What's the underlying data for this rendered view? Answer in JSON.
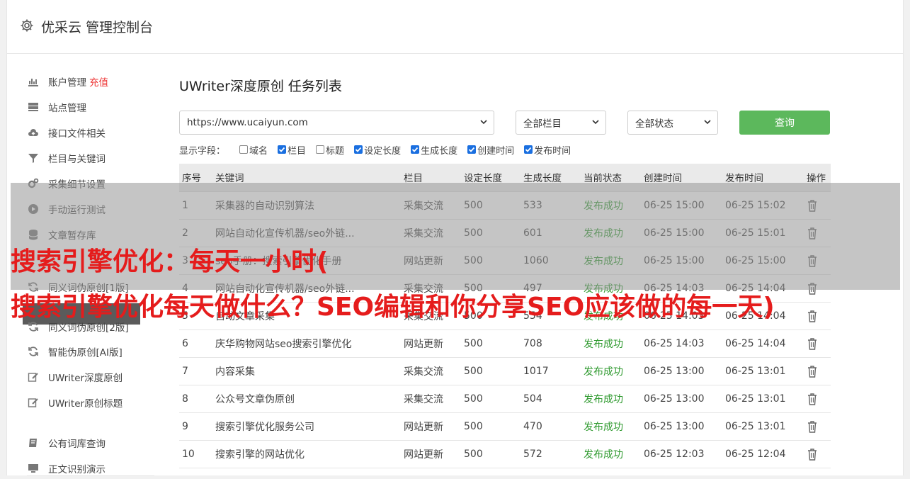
{
  "app": {
    "title": "优采云 管理控制台"
  },
  "sidebar": {
    "items": [
      {
        "label": "账户管理",
        "extra": "充值",
        "icon": "bar-chart-icon"
      },
      {
        "label": "站点管理",
        "icon": "server-icon"
      },
      {
        "label": "接口文件相关",
        "icon": "cloud-upload-icon"
      },
      {
        "label": "栏目与关键词",
        "icon": "filter-icon"
      },
      {
        "label": "采集细节设置",
        "icon": "cogs-icon"
      },
      {
        "label": "手动运行测试",
        "icon": "play-icon"
      },
      {
        "label": "文章暂存库",
        "icon": "database-icon"
      },
      {
        "label": "深度原创任务",
        "icon": "edit-icon"
      },
      {
        "label": "同义词伪原创[1版]",
        "icon": "refresh-icon"
      },
      {
        "label": "同义词伪原创[2版]",
        "icon": "refresh-icon"
      },
      {
        "label": "智能伪原创[AI版]",
        "icon": "refresh-icon"
      },
      {
        "label": "UWriter深度原创",
        "icon": "edit-icon"
      },
      {
        "label": "UWriter原创标题",
        "icon": "edit-icon"
      },
      {
        "label": "公有词库查询",
        "icon": "book-icon"
      },
      {
        "label": "正文识别演示",
        "icon": "monitor-icon"
      }
    ]
  },
  "main": {
    "title": "UWriter深度原创 任务列表",
    "site_select": "https://www.ucaiyun.com",
    "column_select": "全部栏目",
    "status_select": "全部状态",
    "query_label": "查询",
    "fields_label": "显示字段：",
    "fields": [
      {
        "label": "域名",
        "checked": false
      },
      {
        "label": "栏目",
        "checked": true
      },
      {
        "label": "标题",
        "checked": false
      },
      {
        "label": "设定长度",
        "checked": true
      },
      {
        "label": "生成长度",
        "checked": true
      },
      {
        "label": "创建时间",
        "checked": true
      },
      {
        "label": "发布时间",
        "checked": true
      }
    ],
    "table": {
      "headers": [
        "序号",
        "关键词",
        "栏目",
        "设定长度",
        "生成长度",
        "当前状态",
        "创建时间",
        "发布时间",
        "操作"
      ],
      "rows": [
        [
          "1",
          "采集器的自动识别算法",
          "采集交流",
          "500",
          "533",
          "发布成功",
          "06-25 15:00",
          "06-25 15:02"
        ],
        [
          "2",
          "网站自动化宣传机器/seo外链...",
          "采集交流",
          "500",
          "601",
          "发布成功",
          "06-25 15:00",
          "06-25 15:01"
        ],
        [
          "3",
          "seo手册：搜索引擎优化手册",
          "网站更新",
          "500",
          "1060",
          "发布成功",
          "06-25 15:00",
          "06-25 15:00"
        ],
        [
          "4",
          "网站自动化宣传机器/seo外链...",
          "采集交流",
          "500",
          "497",
          "发布成功",
          "06-25 14:03",
          "06-25 14:04"
        ],
        [
          "5",
          "自动文章采集",
          "采集交流",
          "500",
          "554",
          "发布成功",
          "06-25 14:03",
          "06-25 14:04"
        ],
        [
          "6",
          "庆华购物网站seo搜索引擎优化",
          "网站更新",
          "500",
          "708",
          "发布成功",
          "06-25 14:03",
          "06-25 14:04"
        ],
        [
          "7",
          "内容采集",
          "采集交流",
          "500",
          "1017",
          "发布成功",
          "06-25 13:00",
          "06-25 13:01"
        ],
        [
          "8",
          "公众号文章伪原创",
          "采集交流",
          "500",
          "504",
          "发布成功",
          "06-25 13:00",
          "06-25 13:01"
        ],
        [
          "9",
          "搜索引擎优化服务公司",
          "网站更新",
          "500",
          "470",
          "发布成功",
          "06-25 13:00",
          "06-25 13:01"
        ],
        [
          "10",
          "搜索引擎的网站优化",
          "网站更新",
          "500",
          "572",
          "发布成功",
          "06-25 12:03",
          "06-25 12:04"
        ]
      ]
    }
  },
  "overlay": {
    "line1": "搜索引擎优化：每天一小时(",
    "line2": "搜索引擎优化每天做什么？SEO编辑和你分享SEO应该做的每一天)"
  }
}
